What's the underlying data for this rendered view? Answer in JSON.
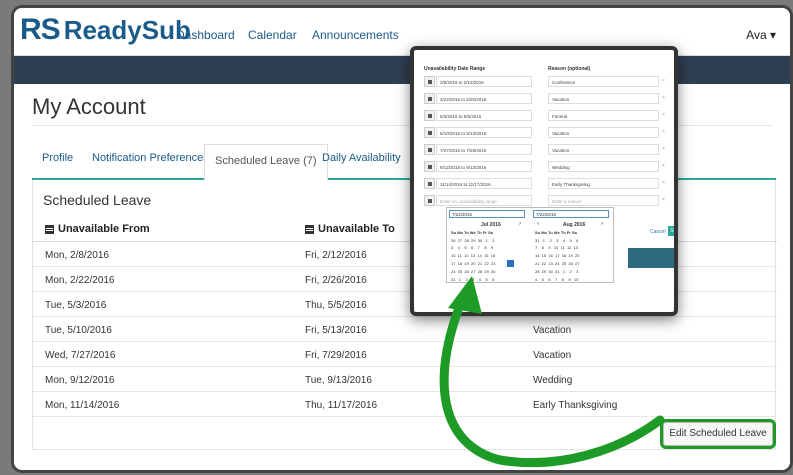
{
  "nav": {
    "logo_rs": "RS",
    "logo_name": "ReadySub",
    "dashboard": "Dashboard",
    "calendar": "Calendar",
    "announcements": "Announcements",
    "user": "Ava ▾"
  },
  "page": {
    "title": "My Account"
  },
  "tabs": [
    "Profile",
    "Notification Preferences",
    "Scheduled Leave (7)",
    "Daily Availability"
  ],
  "panel": {
    "title": "Scheduled Leave",
    "col_from": "Unavailable From",
    "col_to": "Unavailable To",
    "rows": [
      {
        "from": "Mon, 2/8/2016",
        "to": "Fri, 2/12/2016",
        "reason": ""
      },
      {
        "from": "Mon, 2/22/2016",
        "to": "Fri, 2/26/2016",
        "reason": ""
      },
      {
        "from": "Tue, 5/3/2016",
        "to": "Thu, 5/5/2016",
        "reason": ""
      },
      {
        "from": "Tue, 5/10/2016",
        "to": "Fri, 5/13/2016",
        "reason": "Vacation"
      },
      {
        "from": "Wed, 7/27/2016",
        "to": "Fri, 7/29/2016",
        "reason": "Vacation"
      },
      {
        "from": "Mon, 9/12/2016",
        "to": "Tue, 9/13/2016",
        "reason": "Wedding"
      },
      {
        "from": "Mon, 11/14/2016",
        "to": "Thu, 11/17/2016",
        "reason": "Early Thanksgiving"
      }
    ],
    "edit_button": "Edit Scheduled Leave"
  },
  "popup": {
    "hdr_range": "Unavailability Date Range",
    "hdr_reason": "Reason (optional)",
    "rows": [
      {
        "range": "2/8/2016 to 2/12/2016",
        "reason": "Conference"
      },
      {
        "range": "2/22/2016 to 2/26/2016",
        "reason": "Vacation"
      },
      {
        "range": "5/3/2016 to 5/5/2016",
        "reason": "Funeral"
      },
      {
        "range": "5/10/2016 to 5/13/2016",
        "reason": "Vacation"
      },
      {
        "range": "7/27/2016 to 7/29/2016",
        "reason": "Vacation"
      },
      {
        "range": "9/12/2016 to 9/13/2016",
        "reason": "Wedding"
      },
      {
        "range": "11/14/2016 to 11/17/2016",
        "reason": "Early Thanksgiving"
      }
    ],
    "range_placeholder": "Enter an unavailability range",
    "reason_placeholder": "Enter a reason",
    "picker_from": "7/22/2016",
    "picker_to": "7/22/2016",
    "month1": "Jul 2016",
    "month2": "Aug 2016",
    "dow": "Su  Mo  Tu  We  Th  Fr  Sa",
    "m1_weeks": [
      "26  27  28  29  30   1    2",
      "3    4    5    6    7    8    9",
      "10  11  12  13  14  15  16",
      "17  18  19  20  21  22  23",
      "24  25  26  27  28  29  30",
      "31   1    2    3    4    5    6"
    ],
    "m2_weeks": [
      "31   1    2    3    4    5    6",
      "7    8    9   10  11  12  13",
      "14  15  16  17  18  19  20",
      "21  22  23  24  25  26  27",
      "28  29  30  31   1    2    3",
      "4    5    6    7    8    9   10"
    ],
    "cancel": "Cancel",
    "save": "Save"
  },
  "colors": {
    "brand": "#1a5b8a",
    "accent": "#2aa89a",
    "highlight": "#1e9a27"
  }
}
